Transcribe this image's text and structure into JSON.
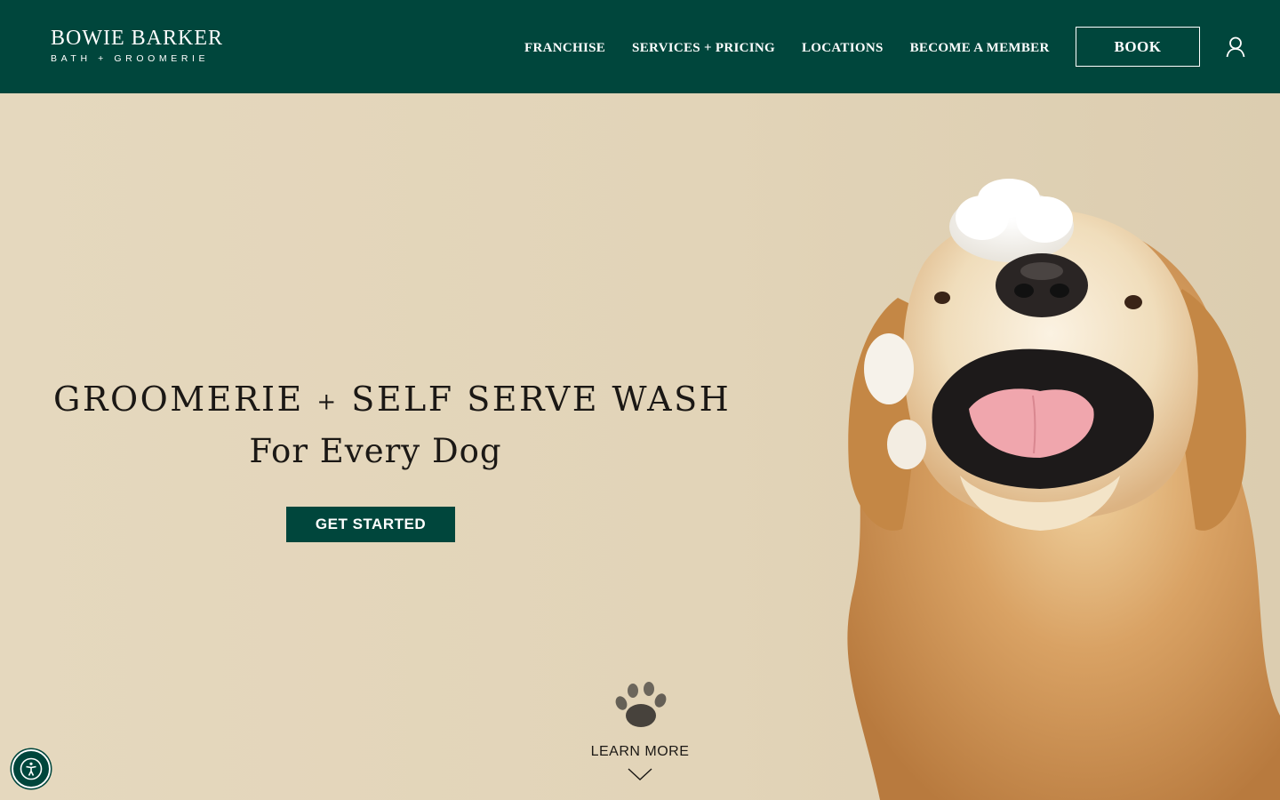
{
  "brand": {
    "name": "BOWIE BARKER",
    "tagline": "BATH + GROOMERIE"
  },
  "nav": {
    "items": [
      {
        "label": "FRANCHISE"
      },
      {
        "label": "SERVICES + PRICING"
      },
      {
        "label": "LOCATIONS"
      },
      {
        "label": "BECOME A MEMBER"
      }
    ],
    "book_label": "BOOK",
    "account_icon": "user-icon"
  },
  "hero": {
    "headline_left": "GROOMERIE",
    "headline_plus": "+",
    "headline_right": "SELF SERVE WASH",
    "subheadline": "For Every Dog",
    "cta_label": "GET STARTED",
    "learn_more_label": "LEARN MORE",
    "paw_icon": "paw-print-icon",
    "chevron_icon": "chevron-down-icon"
  },
  "accessibility": {
    "icon": "accessibility-icon"
  },
  "colors": {
    "brand_green": "#00463c",
    "hero_background": "#e3d6bd",
    "text_dark": "#1b1815"
  }
}
